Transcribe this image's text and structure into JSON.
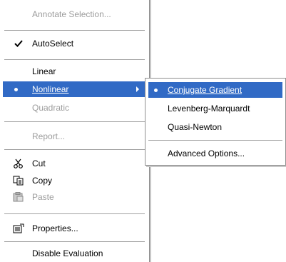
{
  "main_menu": {
    "annotate": "Annotate Selection...",
    "autoselect": "AutoSelect",
    "linear": "Linear",
    "nonlinear": "Nonlinear",
    "quadratic": "Quadratic",
    "report": "Report...",
    "cut": "Cut",
    "copy": "Copy",
    "paste": "Paste",
    "properties": "Properties...",
    "disable_eval": "Disable Evaluation"
  },
  "sub_menu": {
    "conjugate": "Conjugate Gradient",
    "levenberg": "Levenberg-Marquardt",
    "quasi": "Quasi-Newton",
    "advanced": "Advanced Options..."
  },
  "colors": {
    "highlight": "#316ac5",
    "disabled": "#9c9c9c"
  },
  "icons": [
    "check-icon",
    "bullet-icon",
    "submenu-arrow-icon",
    "scissors-icon",
    "copy-icon",
    "paste-icon",
    "properties-icon"
  ]
}
